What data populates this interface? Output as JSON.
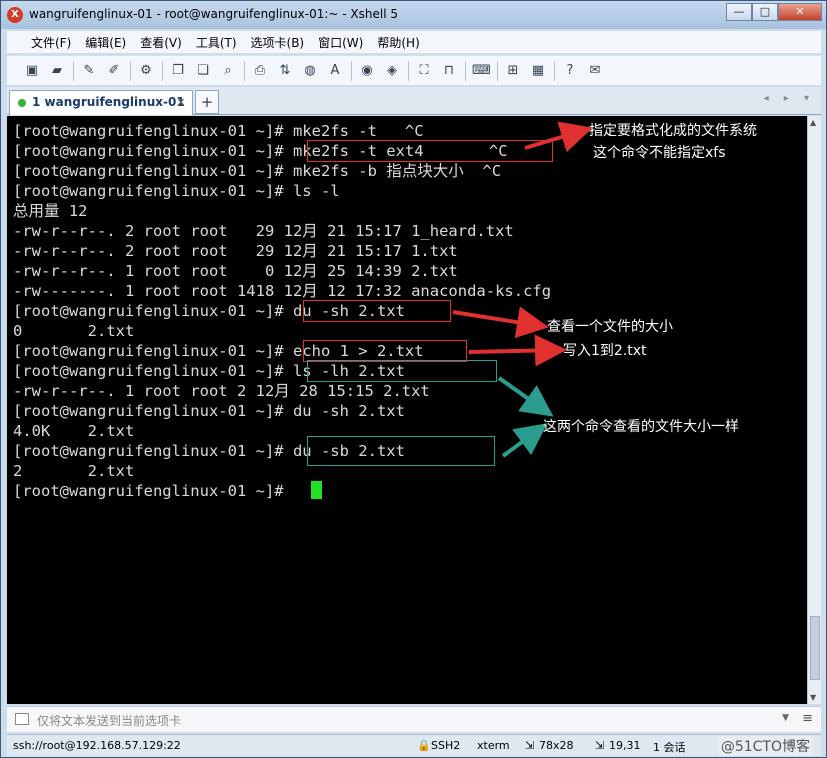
{
  "window": {
    "title": "wangruifenglinux-01 - root@wangruifenglinux-01:~ - Xshell 5",
    "app_icon": "xshell-logo-icon",
    "buttons": {
      "minimize": "—",
      "maximize": "□",
      "close": "✕"
    }
  },
  "menu": [
    "文件(F)",
    "编辑(E)",
    "查看(V)",
    "工具(T)",
    "选项卡(B)",
    "窗口(W)",
    "帮助(H)"
  ],
  "toolbar_icons": [
    "new-session-icon",
    "open-folder-icon",
    "connect-icon",
    "disconnect-icon",
    "properties-icon",
    "copy-icon",
    "paste-icon",
    "find-icon",
    "print-icon",
    "transfer-icon",
    "globe-icon",
    "font-icon",
    "script-icon",
    "sftp-icon",
    "fullscreen-icon",
    "lock-icon",
    "keyboard-icon",
    "add-icon",
    "layout-icon",
    "help-icon",
    "chat-icon"
  ],
  "tabs": [
    {
      "index": "1",
      "label": "wangruifenglinux-01",
      "close": "×",
      "status_color": "#3bb03b"
    }
  ],
  "tab_add": "+",
  "tab_nav": "◂ ▸ ▾",
  "terminal": {
    "lines": [
      "[root@wangruifenglinux-01 ~]# mke2fs -t   ^C",
      "[root@wangruifenglinux-01 ~]# mke2fs -t ext4       ^C",
      "[root@wangruifenglinux-01 ~]# mke2fs -b 指点块大小  ^C",
      "[root@wangruifenglinux-01 ~]# ls -l",
      "总用量 12",
      "-rw-r--r--. 2 root root   29 12月 21 15:17 1_heard.txt",
      "-rw-r--r--. 2 root root   29 12月 21 15:17 1.txt",
      "-rw-r--r--. 1 root root    0 12月 25 14:39 2.txt",
      "-rw-------. 1 root root 1418 12月 12 17:32 anaconda-ks.cfg",
      "[root@wangruifenglinux-01 ~]# du -sh 2.txt",
      "0       2.txt",
      "[root@wangruifenglinux-01 ~]# echo 1 > 2.txt",
      "[root@wangruifenglinux-01 ~]# ls -lh 2.txt",
      "-rw-r--r--. 1 root root 2 12月 28 15:15 2.txt",
      "[root@wangruifenglinux-01 ~]# du -sh 2.txt",
      "4.0K    2.txt",
      "[root@wangruifenglinux-01 ~]# du -sb 2.txt",
      "2       2.txt",
      "[root@wangruifenglinux-01 ~]# "
    ],
    "cursor_color": "#22e022"
  },
  "annotations": {
    "a1_line1": "指定要格式化成的文件系统",
    "a1_line2": "这个命令不能指定xfs",
    "a2": "查看一个文件的大小",
    "a3": "写入1到2.txt",
    "a4": "这两个命令查看的文件大小一样",
    "red": "#e03030",
    "teal": "#2a9d8f"
  },
  "sendbar": {
    "placeholder": "仅将文本发送到当前选项卡"
  },
  "status": {
    "connection": "ssh://root@192.168.57.129:22",
    "protocol": "SSH2",
    "terminal_type": "xterm",
    "size": "78x28",
    "cursor_pos": "19,31",
    "sessions": "1 会话",
    "watermark": "@51CTO博客"
  }
}
